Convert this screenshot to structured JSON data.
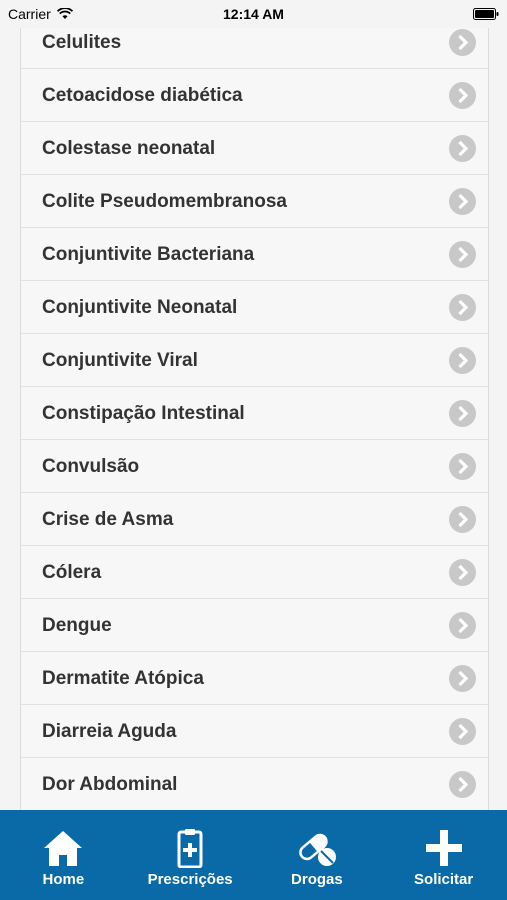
{
  "status_bar": {
    "carrier": "Carrier",
    "time": "12:14 AM"
  },
  "list": {
    "items": [
      {
        "label": "Celulites"
      },
      {
        "label": "Cetoacidose diabética"
      },
      {
        "label": "Colestase neonatal"
      },
      {
        "label": "Colite Pseudomembranosa"
      },
      {
        "label": "Conjuntivite Bacteriana"
      },
      {
        "label": "Conjuntivite Neonatal"
      },
      {
        "label": "Conjuntivite Viral"
      },
      {
        "label": "Constipação Intestinal"
      },
      {
        "label": "Convulsão"
      },
      {
        "label": "Crise de Asma"
      },
      {
        "label": "Cólera"
      },
      {
        "label": "Dengue"
      },
      {
        "label": "Dermatite Atópica"
      },
      {
        "label": "Diarreia Aguda"
      },
      {
        "label": "Dor Abdominal"
      }
    ]
  },
  "tab_bar": {
    "tabs": [
      {
        "label": "Home",
        "icon": "home-icon"
      },
      {
        "label": "Prescrições",
        "icon": "clipboard-icon"
      },
      {
        "label": "Drogas",
        "icon": "pills-icon"
      },
      {
        "label": "Solicitar",
        "icon": "plus-icon"
      }
    ]
  },
  "colors": {
    "tab_bar_background": "#0a6aa7",
    "chevron": "#c8c8c8",
    "item_text": "#333333"
  }
}
